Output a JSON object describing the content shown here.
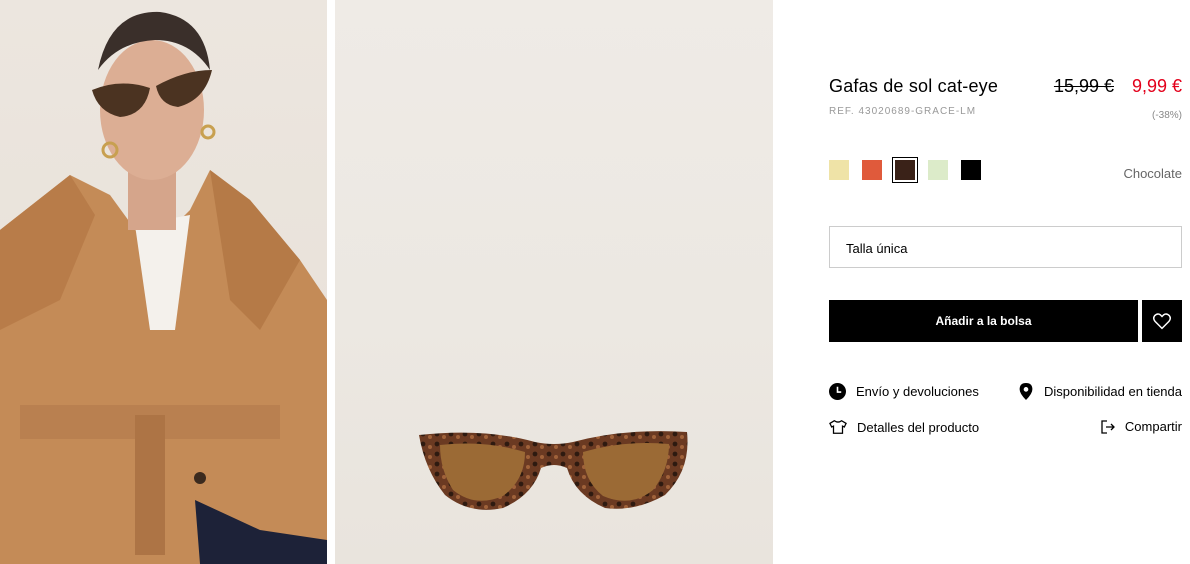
{
  "product": {
    "title": "Gafas de sol cat-eye",
    "ref": "REF. 43020689-GRACE-LM",
    "old_price": "15,99 €",
    "new_price": "9,99 €",
    "discount": "(-38%)"
  },
  "colors": {
    "swatches": [
      "#efe3a7",
      "#e05a3b",
      "#3a2218",
      "#dcebc9",
      "#000000"
    ],
    "selected_index": 2,
    "selected_name": "Chocolate"
  },
  "size": {
    "value": "Talla única"
  },
  "actions": {
    "add_to_bag": "Añadir a la bolsa",
    "wishlist_icon": "heart-icon"
  },
  "links": {
    "shipping": "Envío y devoluciones",
    "availability": "Disponibilidad en tienda",
    "details": "Detalles del producto",
    "share": "Compartir"
  },
  "accent": {
    "sale": "#e3001b"
  }
}
